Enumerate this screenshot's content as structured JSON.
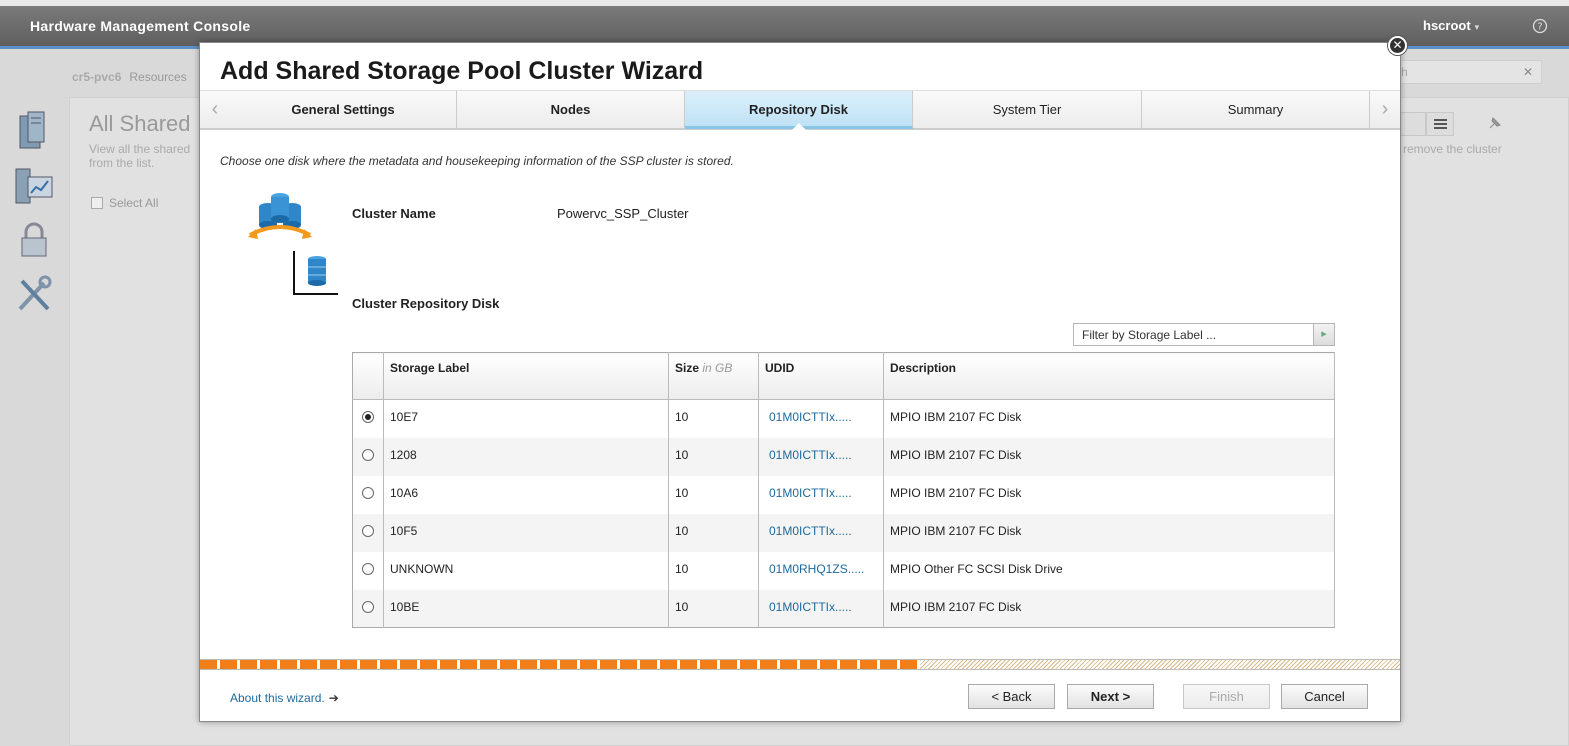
{
  "console": {
    "app_title": "Hardware Management Console",
    "user": "hscroot",
    "user_caret": "▾",
    "help_glyph": "?",
    "breadcrumb": {
      "system": "cr5-pvc6",
      "section": "Resources"
    },
    "heading": "All Shared",
    "description": "View all the shared from the list.",
    "select_all": "Select All",
    "search_value": "h",
    "search_clear": "✕",
    "right_description": "remove the cluster"
  },
  "wizard": {
    "title": "Add Shared Storage Pool Cluster Wizard",
    "close_glyph": "✕",
    "steps": [
      {
        "label": "General Settings"
      },
      {
        "label": "Nodes"
      },
      {
        "label": "Repository Disk"
      },
      {
        "label": "System Tier"
      },
      {
        "label": "Summary"
      }
    ],
    "instruction": "Choose one disk where the metadata and housekeeping information of the SSP cluster is stored.",
    "cluster_name_label": "Cluster Name",
    "cluster_name_value": "Powervc_SSP_Cluster",
    "repository_label": "Cluster Repository Disk",
    "filter_placeholder": "Filter by Storage Label ...",
    "filter_go_glyph": "▸",
    "table": {
      "headers": {
        "storage_label": "Storage Label",
        "size": "Size",
        "size_unit": "in GB",
        "udid": "UDID",
        "description": "Description"
      },
      "rows": [
        {
          "label": "10E7",
          "size": "10",
          "udid": "01M0ICTTIx.....",
          "description": "MPIO IBM 2107 FC Disk",
          "selected": true
        },
        {
          "label": "1208",
          "size": "10",
          "udid": "01M0ICTTIx.....",
          "description": "MPIO IBM 2107 FC Disk",
          "selected": false
        },
        {
          "label": "10A6",
          "size": "10",
          "udid": "01M0ICTTIx.....",
          "description": "MPIO IBM 2107 FC Disk",
          "selected": false
        },
        {
          "label": "10F5",
          "size": "10",
          "udid": "01M0ICTTIx.....",
          "description": "MPIO IBM 2107 FC Disk",
          "selected": false
        },
        {
          "label": "UNKNOWN",
          "size": "10",
          "udid": "01M0RHQ1ZS.....",
          "description": "MPIO Other FC SCSI Disk Drive",
          "selected": false
        },
        {
          "label": "10BE",
          "size": "10",
          "udid": "01M0ICTTIx.....",
          "description": "MPIO IBM 2107 FC Disk",
          "selected": false
        }
      ]
    },
    "progress": 0.6,
    "about_link": "About this wizard.",
    "about_arrow": "➔",
    "buttons": {
      "back": "< Back",
      "next": "Next >",
      "finish": "Finish",
      "cancel": "Cancel"
    },
    "colors": {
      "progress": "#f07f1a",
      "active_step": "#bfe2f5",
      "link": "#1e6a9c"
    }
  }
}
